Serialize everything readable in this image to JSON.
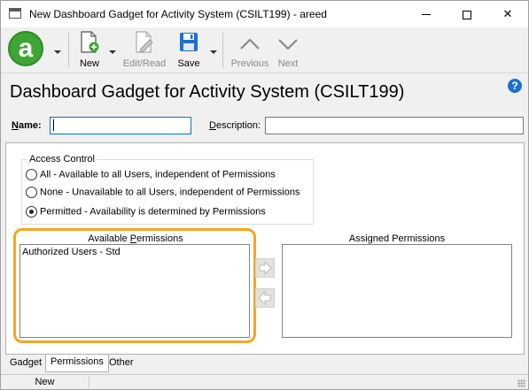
{
  "window": {
    "title": "New Dashboard Gadget for Activity System (CSILT199) - areed",
    "minimize_icon": "minimize-icon",
    "maximize_icon": "maximize-icon",
    "close_glyph": "✕"
  },
  "toolbar": {
    "logo_glyph": "a",
    "new_label": "New",
    "edit_read_label": "Edit/Read",
    "save_label": "Save",
    "previous_label": "Previous",
    "next_label": "Next"
  },
  "header": {
    "title": "Dashboard Gadget for Activity System (CSILT199)",
    "help_glyph": "?"
  },
  "form": {
    "name_label_u": "N",
    "name_label_rest": "ame:",
    "name_value": "",
    "description_label_u": "D",
    "description_label_rest": "escription:",
    "description_value": ""
  },
  "access_control": {
    "title": "Access Control",
    "options": [
      {
        "label": "All - Available to all Users, independent of Permissions",
        "checked": false
      },
      {
        "label": "None - Unavailable to all Users, independent of Permissions",
        "checked": false
      },
      {
        "label": "Permitted - Availability is determined by Permissions",
        "checked": true
      }
    ]
  },
  "permissions": {
    "available_title_pre": "Available ",
    "available_title_u": "P",
    "available_title_post": "ermissions",
    "available_items": [
      "Authorized Users - Std"
    ],
    "assigned_title": "Assigned Permissions",
    "assigned_items": []
  },
  "tabs": [
    {
      "label": "Gadget",
      "active": false
    },
    {
      "label": "Permissions",
      "active": true
    },
    {
      "label": "Other",
      "active": false
    }
  ],
  "status": {
    "mode": "New"
  },
  "colors": {
    "logo_green": "#3fa535",
    "save_blue": "#1f6fd1",
    "highlight_orange": "#f5a623"
  }
}
